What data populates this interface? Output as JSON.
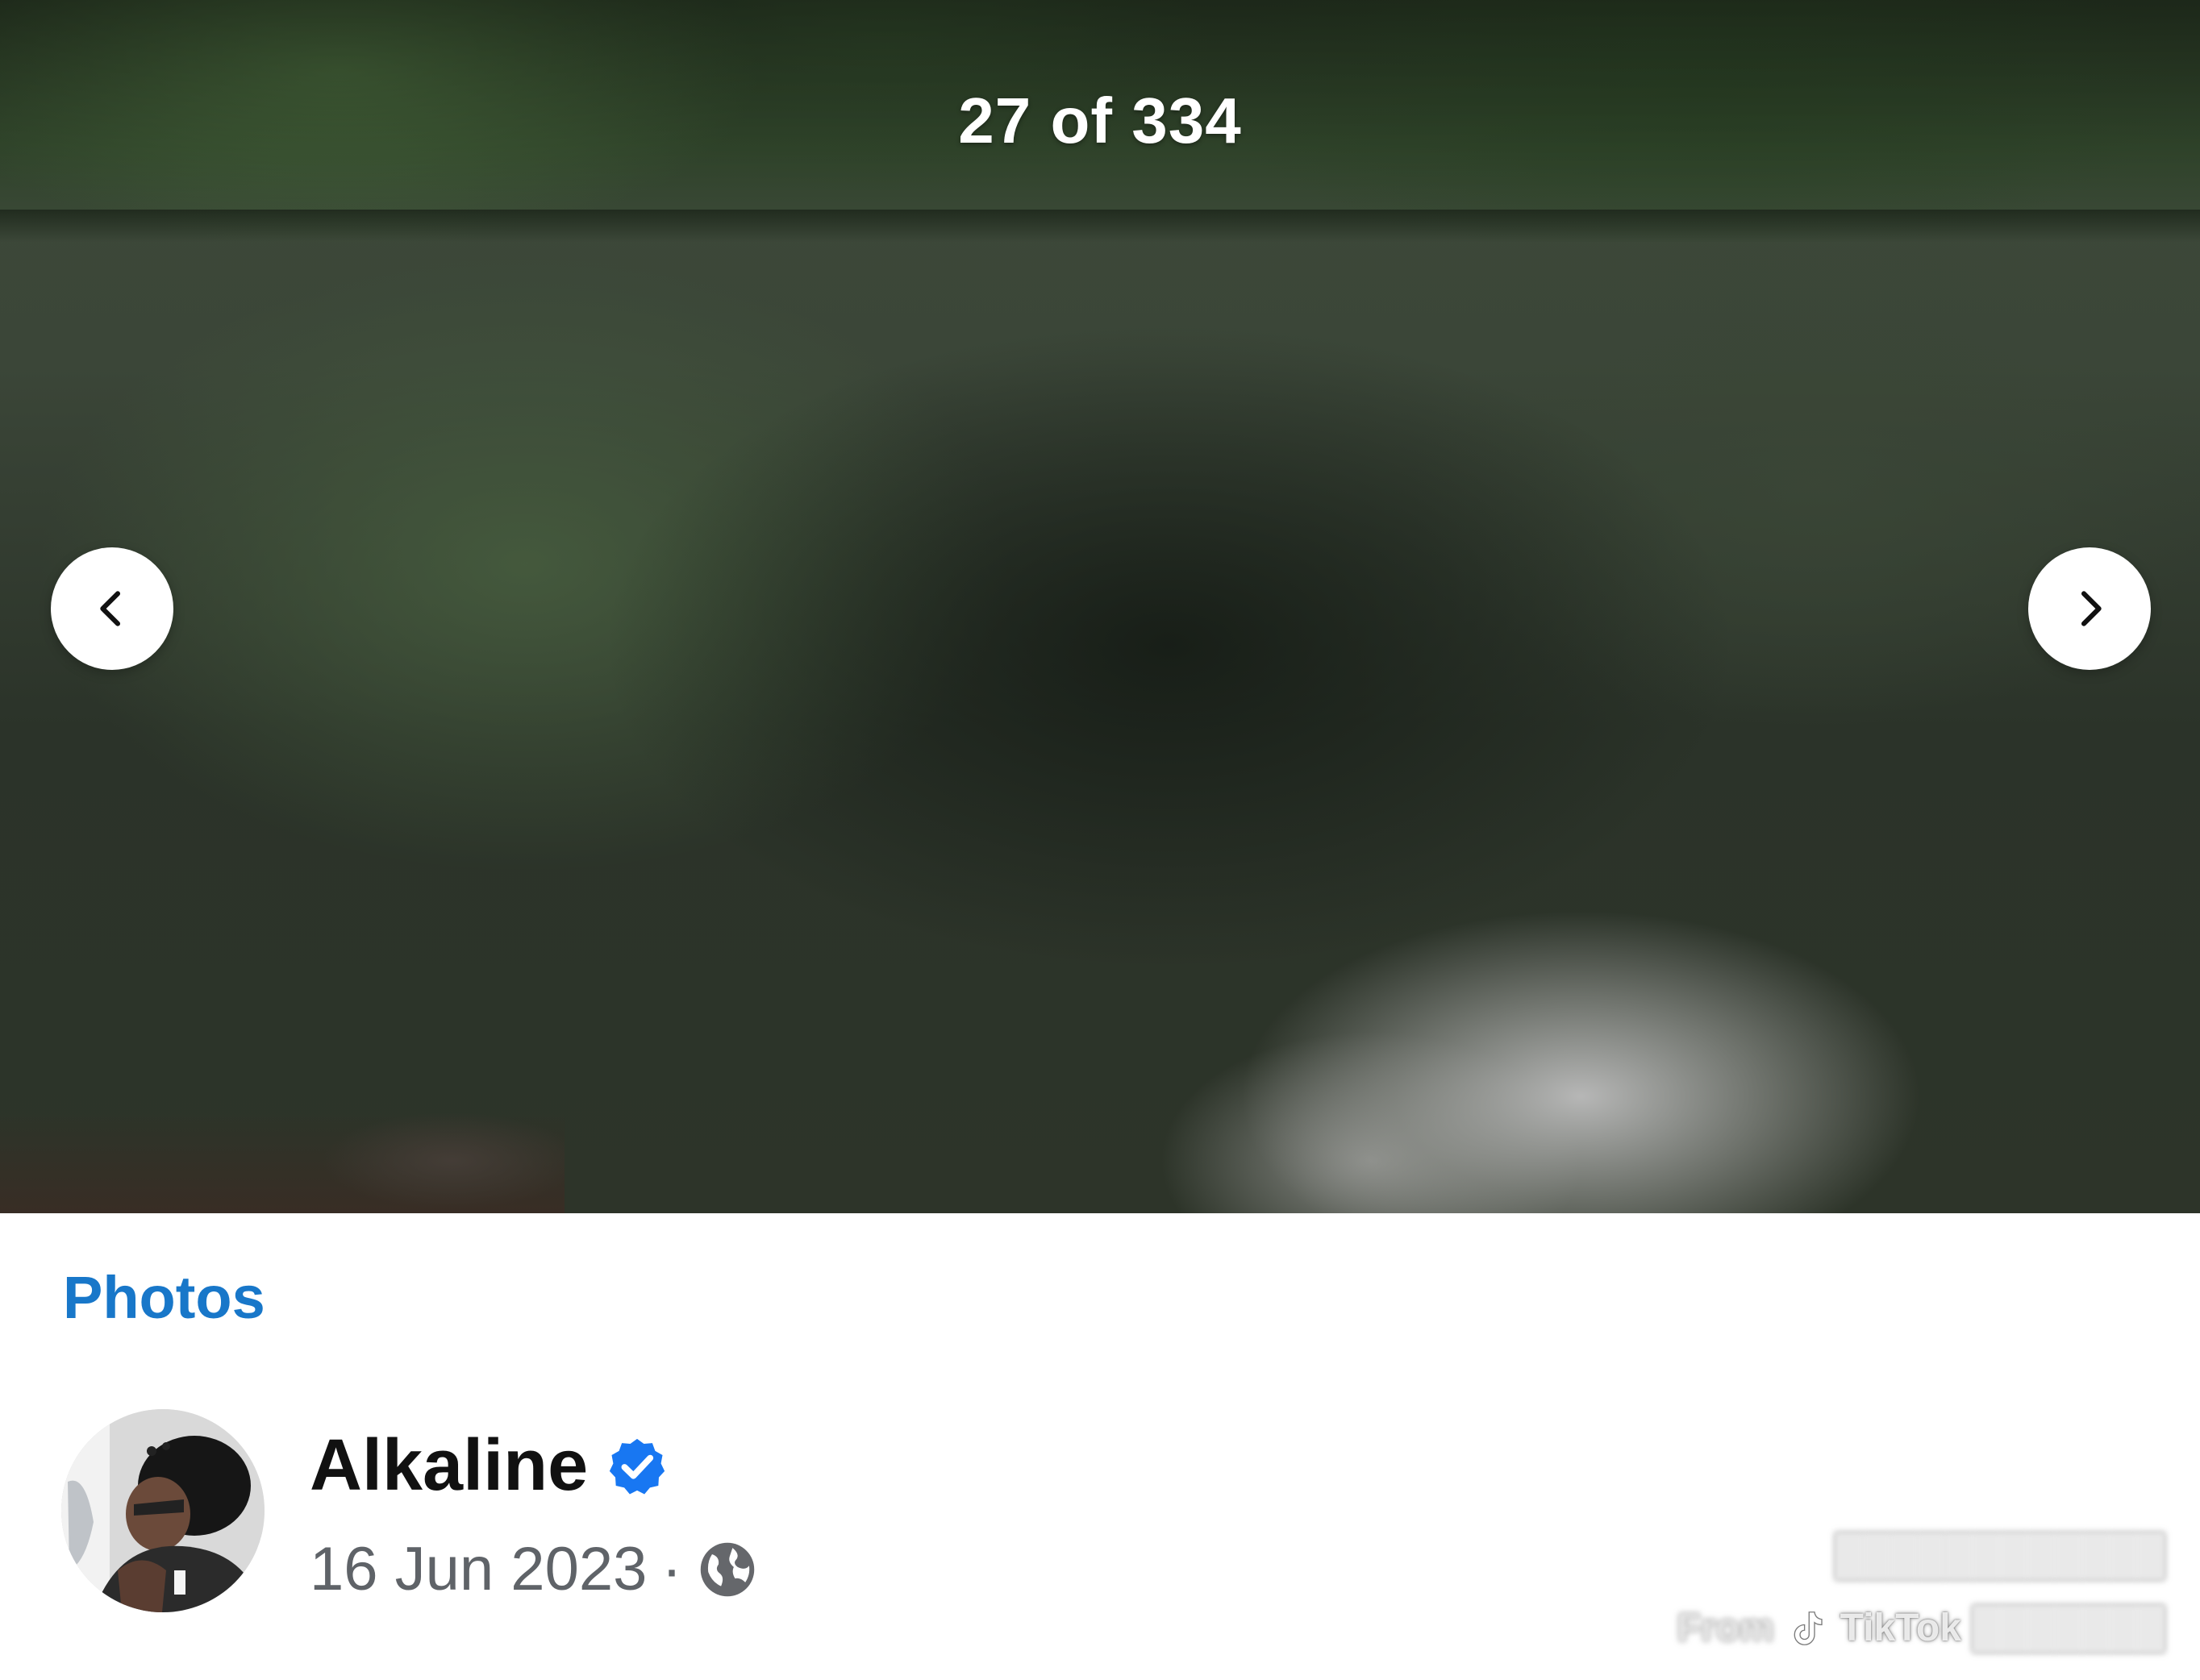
{
  "viewer": {
    "counter": "27 of 334",
    "current_index": 27,
    "total": 334,
    "prev_icon": "chevron-left-icon",
    "next_icon": "chevron-right-icon"
  },
  "post": {
    "album_label": "Photos",
    "author_name": "Alkaline",
    "verified_icon": "verified-badge-icon",
    "date": "16 Jun 2023",
    "separator": "·",
    "privacy_icon": "globe-icon"
  },
  "watermark": {
    "prefix": "From",
    "brand": "TikTok",
    "brand_icon": "tiktok-icon"
  },
  "colors": {
    "link": "#1877c9",
    "verified": "#1877f2",
    "meta_text": "#5f6368"
  }
}
